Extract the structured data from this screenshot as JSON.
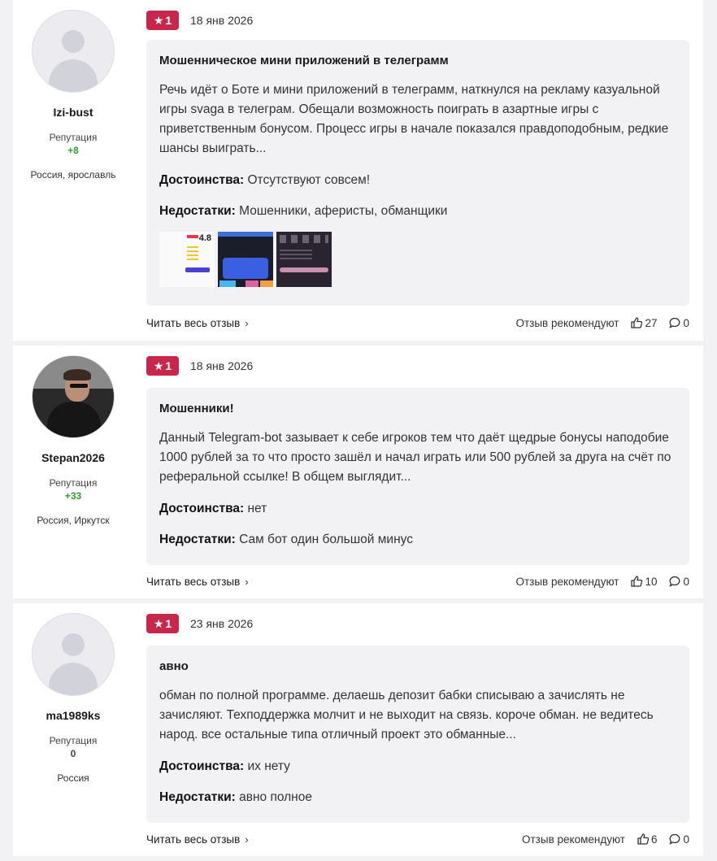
{
  "colors": {
    "rating_badge": "#c8264a",
    "reputation_positive": "#2ea12e"
  },
  "reviews": [
    {
      "author": {
        "name": "Izi-bust",
        "rep_label": "Репутация",
        "rep_value": "+8",
        "location": "Россия, ярославль",
        "avatar": "placeholder-avatar"
      },
      "rating": "1",
      "date": "18 янв 2026",
      "title": "Мошенническое мини приложений в телеграмм",
      "text": "Речь идёт о Боте и мини приложений в телеграмм, наткнулся на рекламу казуальной игры svaga в телеграм. Обещали возможность поиграть в азартные игры с приветственным бонусом. Процесс игры в начале показался правдоподобным, редкие шансы выиграть...",
      "pros_label": "Достоинства:",
      "pros": "Отсутствуют совсем!",
      "cons_label": "Недостатки:",
      "cons": "Мошенники, аферисты, обманщики",
      "thumb_rating": "4.8",
      "read_more": "Читать весь отзыв",
      "recommend": "Отзыв рекомендуют",
      "likes": "27",
      "comments": "0"
    },
    {
      "author": {
        "name": "Stepan2026",
        "rep_label": "Репутация",
        "rep_value": "+33",
        "location": "Россия, Иркутск",
        "avatar": "photo-avatar"
      },
      "rating": "1",
      "date": "18 янв 2026",
      "title": "Мошенники!",
      "text": "Данный Telegram-bot зазывает к себе игроков тем что даёт щедрые бонусы наподобие 1000 рублей за то что просто зашёл и начал играть или 500 рублей за друга на счёт по реферальной ссылке! В общем выглядит...",
      "pros_label": "Достоинства:",
      "pros": "нет",
      "cons_label": "Недостатки:",
      "cons": "Сам бот один большой минус",
      "read_more": "Читать весь отзыв",
      "recommend": "Отзыв рекомендуют",
      "likes": "10",
      "comments": "0"
    },
    {
      "author": {
        "name": "ma1989ks",
        "rep_label": "Репутация",
        "rep_value": "0",
        "location": "Россия",
        "avatar": "placeholder-avatar"
      },
      "rating": "1",
      "date": "23 янв 2026",
      "title": "авно",
      "text": "обман по полной программе. делаешь депозит бабки списываю а зачислять не зачисляют. Техподдержка молчит и не выходит на связь. короче обман. не ведитесь народ. все остальные типа отличный проект это обманные...",
      "pros_label": "Достоинства:",
      "pros": "их нету",
      "cons_label": "Недостатки:",
      "cons": "авно полное",
      "read_more": "Читать весь отзыв",
      "recommend": "Отзыв рекомендуют",
      "likes": "6",
      "comments": "0"
    }
  ]
}
